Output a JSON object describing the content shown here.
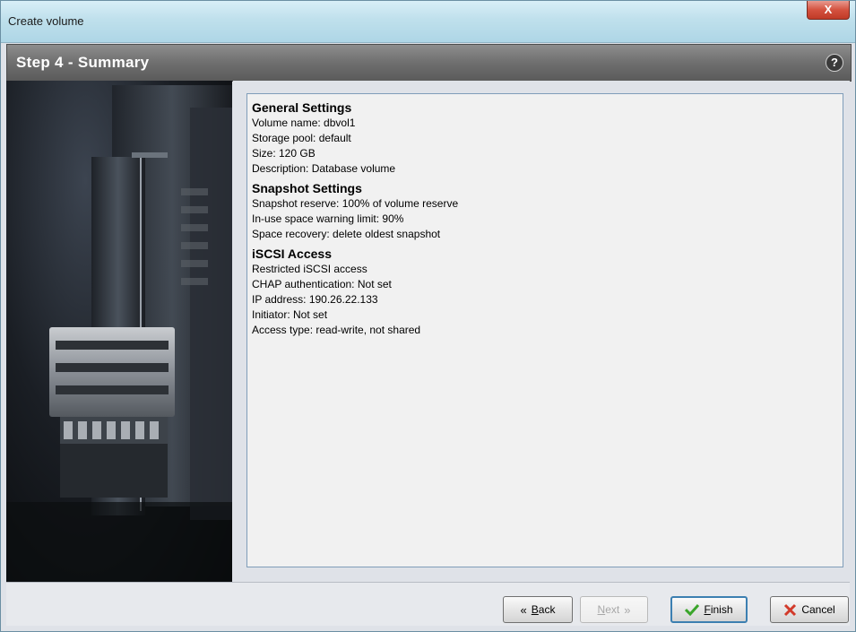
{
  "window": {
    "title": "Create volume",
    "close_label": "X"
  },
  "step": {
    "title": "Step 4 - Summary",
    "help_label": "?"
  },
  "summary": {
    "sections": [
      {
        "title": "General Settings",
        "lines": [
          "Volume name:  dbvol1",
          "Storage pool:  default",
          "Size:  120 GB",
          "Description:  Database volume"
        ]
      },
      {
        "title": "Snapshot Settings",
        "lines": [
          "Snapshot reserve:  100% of volume reserve",
          "In-use space warning limit:  90%",
          "Space recovery:  delete oldest snapshot"
        ]
      },
      {
        "title": "iSCSI Access",
        "lines": [
          "Restricted iSCSI access",
          "CHAP authentication:  Not set",
          "IP address:  190.26.22.133",
          "Initiator:  Not set",
          "Access type:  read-write, not shared"
        ]
      }
    ]
  },
  "buttons": {
    "back": {
      "label_mnemonic": "B",
      "label_rest": "ack",
      "icon": "chevron-left-icon"
    },
    "next": {
      "label_mnemonic": "N",
      "label_rest": "ext",
      "icon": "chevron-right-icon"
    },
    "finish": {
      "label_mnemonic": "F",
      "label_rest": "inish",
      "icon": "checkmark-icon"
    },
    "cancel": {
      "label": "Cancel",
      "icon": "x-cross-icon"
    }
  },
  "colors": {
    "finish_check": "#3aa52a",
    "cancel_x": "#d23a2a"
  }
}
